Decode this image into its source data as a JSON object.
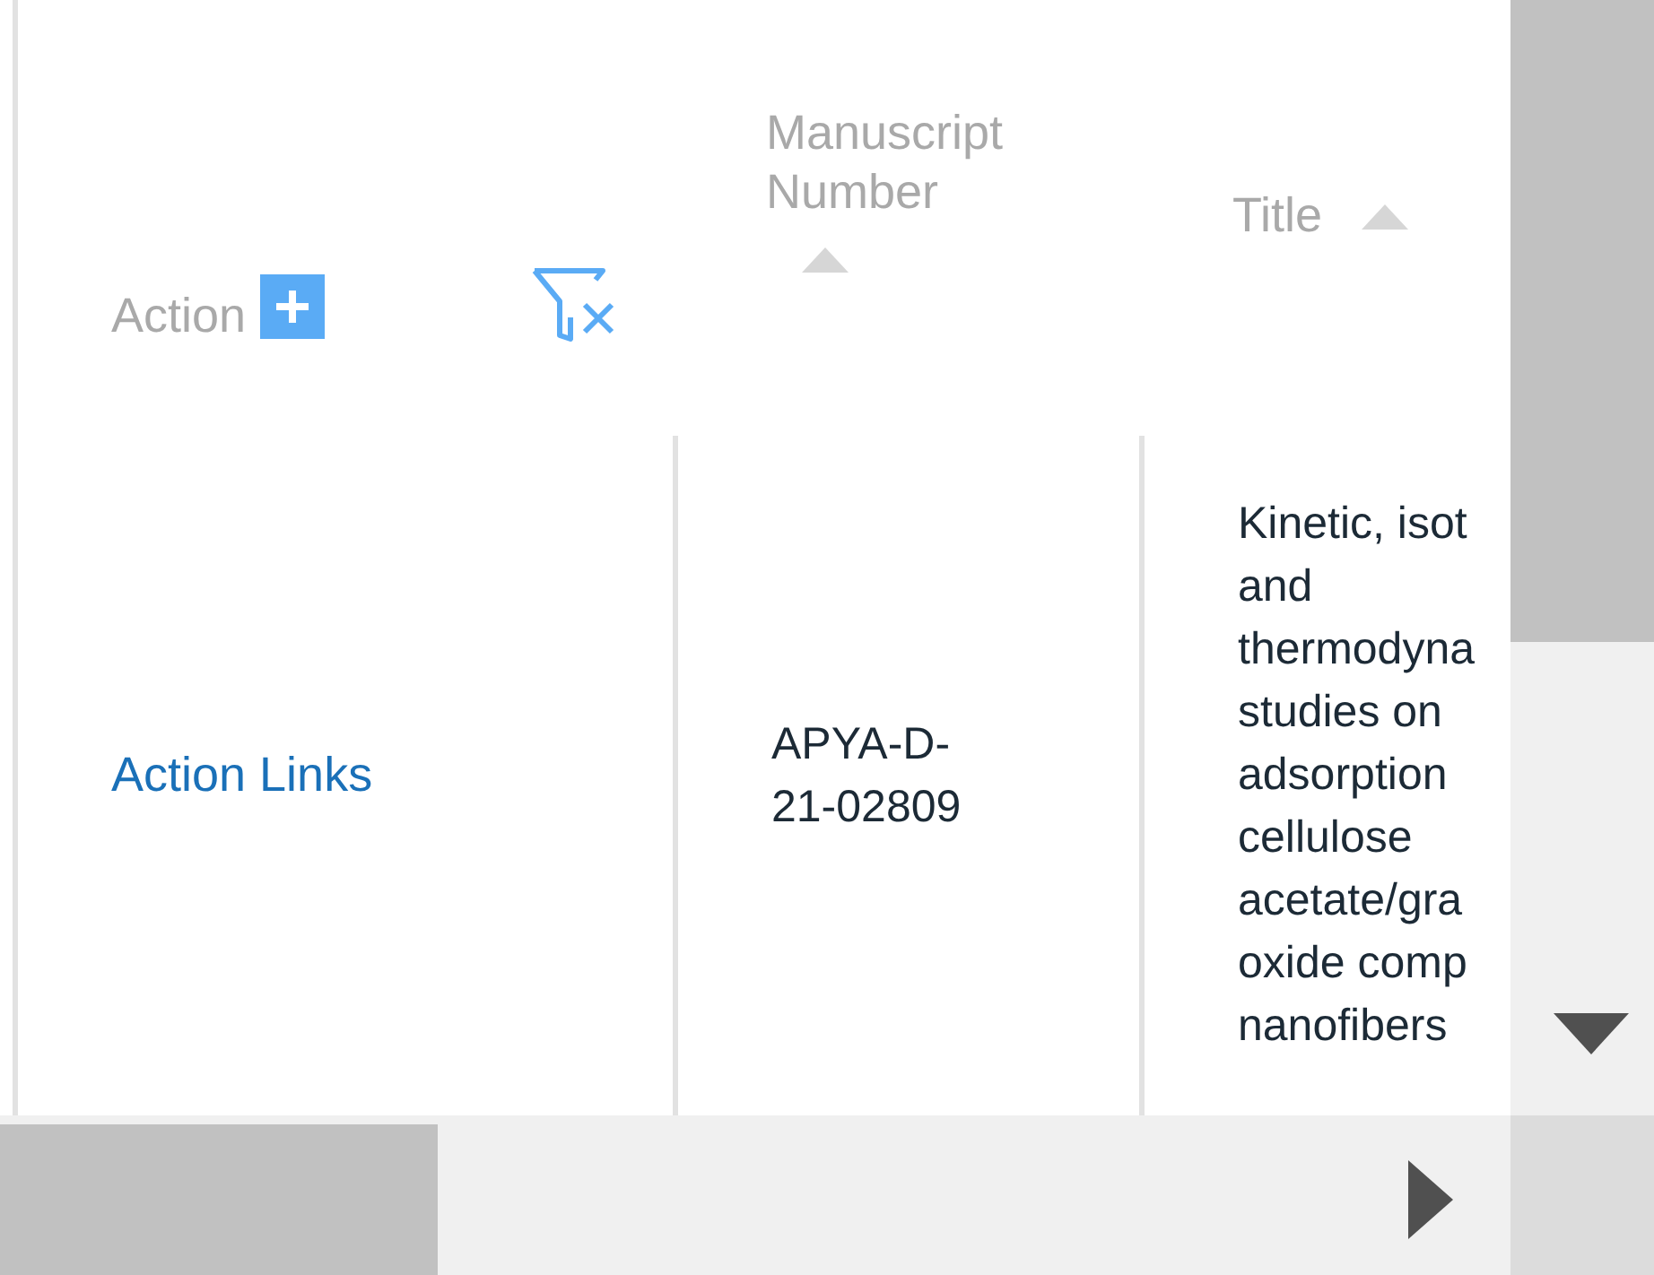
{
  "columns": [
    {
      "label": "Action",
      "kind": "action",
      "sorted": false
    },
    {
      "label": "Manuscript\nNumber",
      "kind": "text",
      "sorted": true
    },
    {
      "label": "Title",
      "kind": "text",
      "sorted": true
    }
  ],
  "rows": [
    {
      "cells": [
        {
          "kind": "link",
          "text": "Action Links"
        },
        {
          "kind": "text",
          "text": "APYA-D-\n21-02809"
        },
        {
          "kind": "text",
          "text": "Kinetic, isot\nand\nthermodyna\nstudies on\nadsorption\ncellulose\nacetate/gra\noxide comp\nnanofibers"
        }
      ]
    }
  ]
}
